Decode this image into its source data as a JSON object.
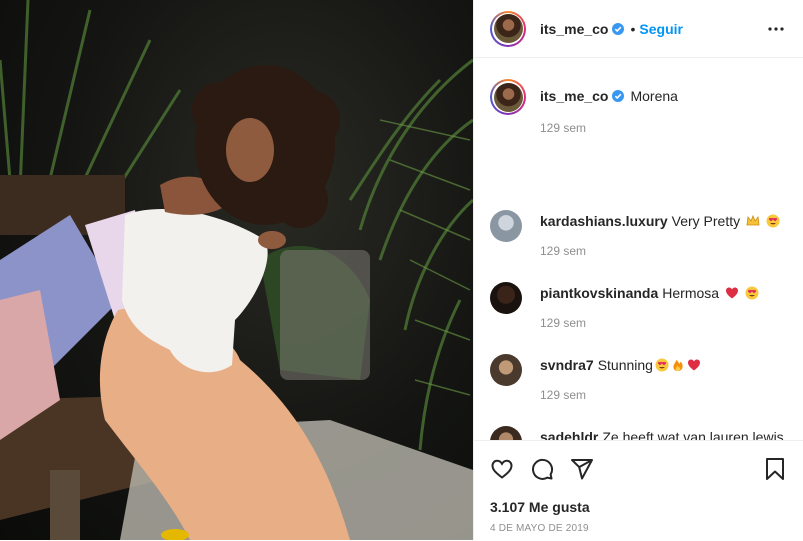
{
  "header": {
    "username": "its_me_co",
    "separator": "•",
    "follow_label": "Seguir"
  },
  "caption": {
    "username": "its_me_co",
    "text": "Morena",
    "time": "129 sem"
  },
  "comments": [
    {
      "username": "kardashians.luxury",
      "text": "Very Pretty",
      "emojis": [
        "crown-emoji",
        "heart-eyes-emoji"
      ],
      "time": "129 sem"
    },
    {
      "username": "piantkovskinanda",
      "text": "Hermosa",
      "emojis": [
        "red-heart-emoji",
        "heart-eyes-emoji"
      ],
      "time": "129 sem"
    },
    {
      "username": "svndra7",
      "text": "Stunning",
      "emojis": [
        "heart-eyes-emoji",
        "fire-emoji",
        "red-heart-emoji"
      ],
      "time": "129 sem"
    },
    {
      "username": "sadehldr",
      "text": "Ze heeft wat van lauren lewis",
      "time": ""
    }
  ],
  "actions": {
    "icons": [
      "heart-icon",
      "comment-icon",
      "share-icon",
      "bookmark-icon"
    ]
  },
  "likes": "3.107 Me gusta",
  "date": "4 DE MAYO DE 2019",
  "colors": {
    "accent": "#0095f6",
    "verified": "#3897f0",
    "muted": "#8e8e8e",
    "border": "#efefef"
  }
}
